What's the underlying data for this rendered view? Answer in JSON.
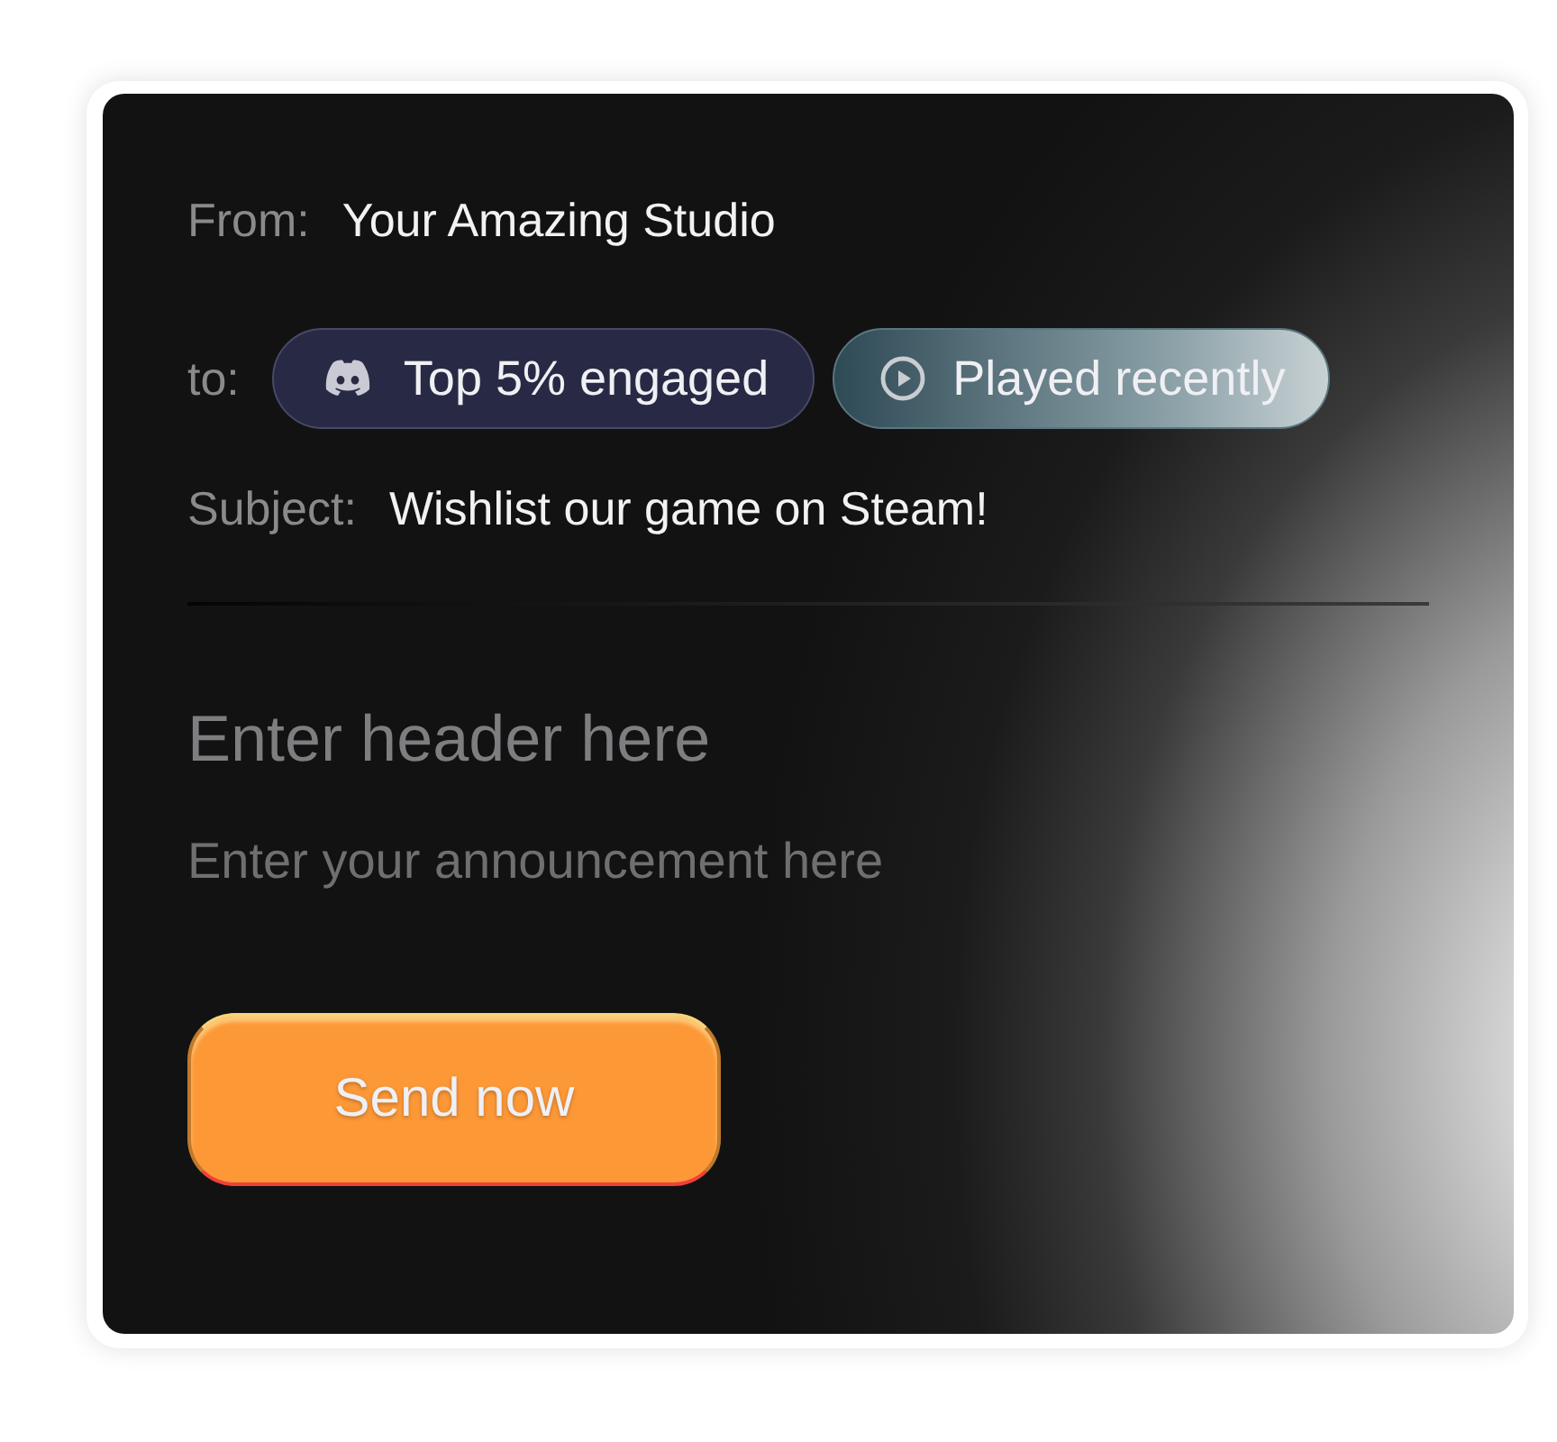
{
  "from": {
    "label": "From:",
    "value": "Your Amazing Studio"
  },
  "to": {
    "label": "to:",
    "recipients": [
      {
        "kind": "discord",
        "label": "Top 5% engaged"
      },
      {
        "kind": "played",
        "label": "Played recently"
      }
    ]
  },
  "subject": {
    "label": "Subject:",
    "value": "Wishlist our game on Steam!"
  },
  "header": {
    "placeholder": "Enter header here"
  },
  "body": {
    "placeholder": "Enter your announcement here"
  },
  "send_button": "Send now"
}
